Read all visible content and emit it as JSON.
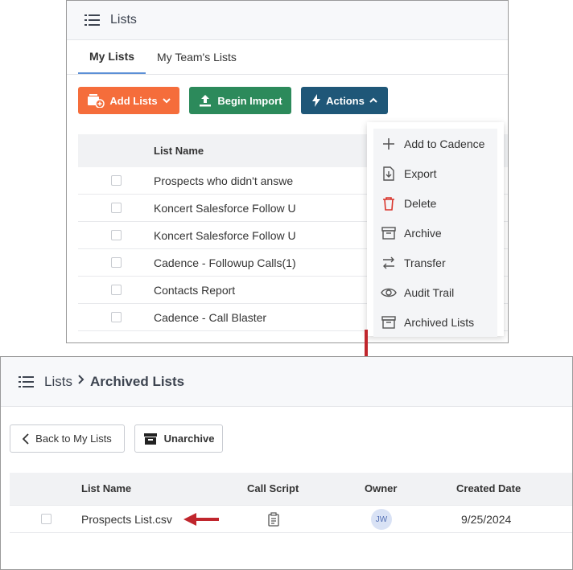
{
  "top": {
    "header_title": "Lists",
    "tabs": [
      {
        "label": "My Lists",
        "active": true
      },
      {
        "label": "My Team's Lists",
        "active": false
      }
    ],
    "buttons": {
      "add_lists": "Add Lists",
      "begin_import": "Begin Import",
      "actions": "Actions"
    },
    "table": {
      "column_name": "List Name",
      "rows": [
        "Prospects who didn't answe",
        "Koncert Salesforce Follow U",
        "Koncert Salesforce Follow U",
        "Cadence - Followup Calls(1)",
        "Contacts Report",
        "Cadence - Call Blaster"
      ]
    },
    "actions_menu": [
      {
        "label": "Add to Cadence",
        "icon": "plus-icon"
      },
      {
        "label": "Export",
        "icon": "export-icon"
      },
      {
        "label": "Delete",
        "icon": "trash-icon"
      },
      {
        "label": "Archive",
        "icon": "archive-icon"
      },
      {
        "label": "Transfer",
        "icon": "transfer-icon"
      },
      {
        "label": "Audit Trail",
        "icon": "eye-icon"
      },
      {
        "label": "Archived Lists",
        "icon": "archive-box-icon"
      }
    ]
  },
  "bottom": {
    "breadcrumb": {
      "root": "Lists",
      "current": "Archived Lists"
    },
    "buttons": {
      "back": "Back to My Lists",
      "unarchive": "Unarchive"
    },
    "table": {
      "columns": [
        "List Name",
        "Call Script",
        "Owner",
        "Created Date"
      ],
      "rows": [
        {
          "name": "Prospects List.csv",
          "owner_initials": "JW",
          "created": "9/25/2024"
        }
      ]
    }
  },
  "colors": {
    "add_button": "#f56d3b",
    "import_button": "#2c8a5b",
    "actions_button": "#1f5778",
    "arrow": "#c0262d",
    "delete_icon": "#d9342b"
  }
}
